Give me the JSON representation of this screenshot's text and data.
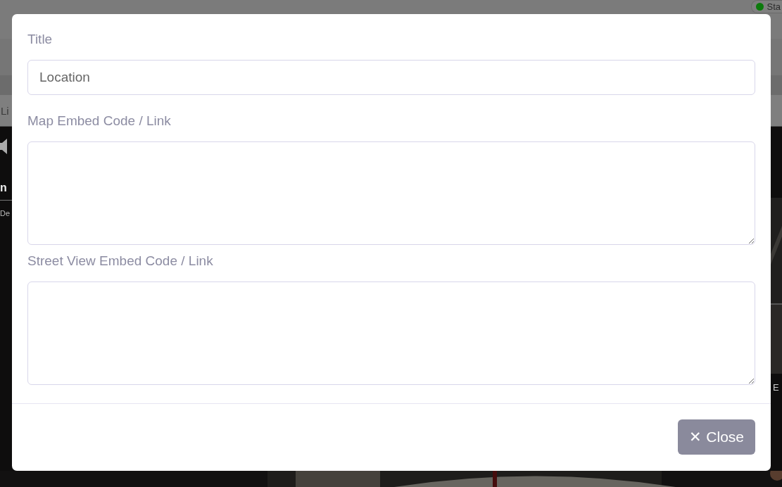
{
  "background": {
    "status": {
      "label": "Sta",
      "color": "#0b7a0b"
    },
    "tab": "Li",
    "heading": "n",
    "description": "De",
    "side_label": "E"
  },
  "modal": {
    "fields": [
      {
        "label": "Title",
        "kind": "input",
        "value": "Location"
      },
      {
        "label": "Map Embed Code / Link",
        "kind": "textarea"
      },
      {
        "label": "Street View Embed Code / Link",
        "kind": "textarea"
      }
    ],
    "close_button": "✕ Close"
  }
}
